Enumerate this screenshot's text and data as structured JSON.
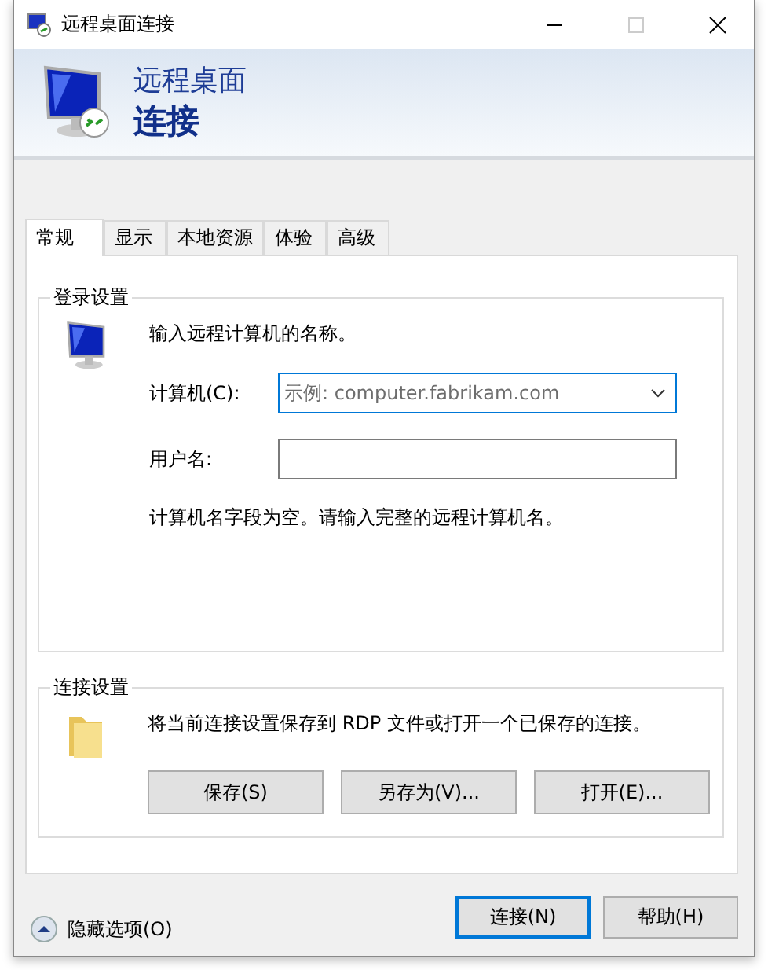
{
  "window": {
    "title": "远程桌面连接"
  },
  "banner": {
    "line1": "远程桌面",
    "line2": "连接"
  },
  "tabs": [
    {
      "label": "常规",
      "selected": true
    },
    {
      "label": "显示",
      "selected": false
    },
    {
      "label": "本地资源",
      "selected": false
    },
    {
      "label": "体验",
      "selected": false
    },
    {
      "label": "高级",
      "selected": false
    }
  ],
  "login_settings": {
    "title": "登录设置",
    "prompt": "输入远程计算机的名称。",
    "fields": [
      {
        "label": "计算机(C):",
        "placeholder": "示例: computer.fabrikam.com",
        "kind": "combo",
        "focused": true
      },
      {
        "label": "用户名:",
        "kind": "text",
        "focused": false
      }
    ],
    "hint": "计算机名字段为空。请输入完整的远程计算机名。"
  },
  "connection_settings": {
    "title": "连接设置",
    "description": "将当前连接设置保存到 RDP 文件或打开一个已保存的连接。",
    "buttons": [
      "保存(S)",
      "另存为(V)...",
      "打开(E)..."
    ]
  },
  "footer": {
    "toggle": "隐藏选项(O)",
    "buttons": [
      {
        "label": "连接(N)",
        "default": true
      },
      {
        "label": "帮助(H)",
        "default": false
      }
    ]
  }
}
